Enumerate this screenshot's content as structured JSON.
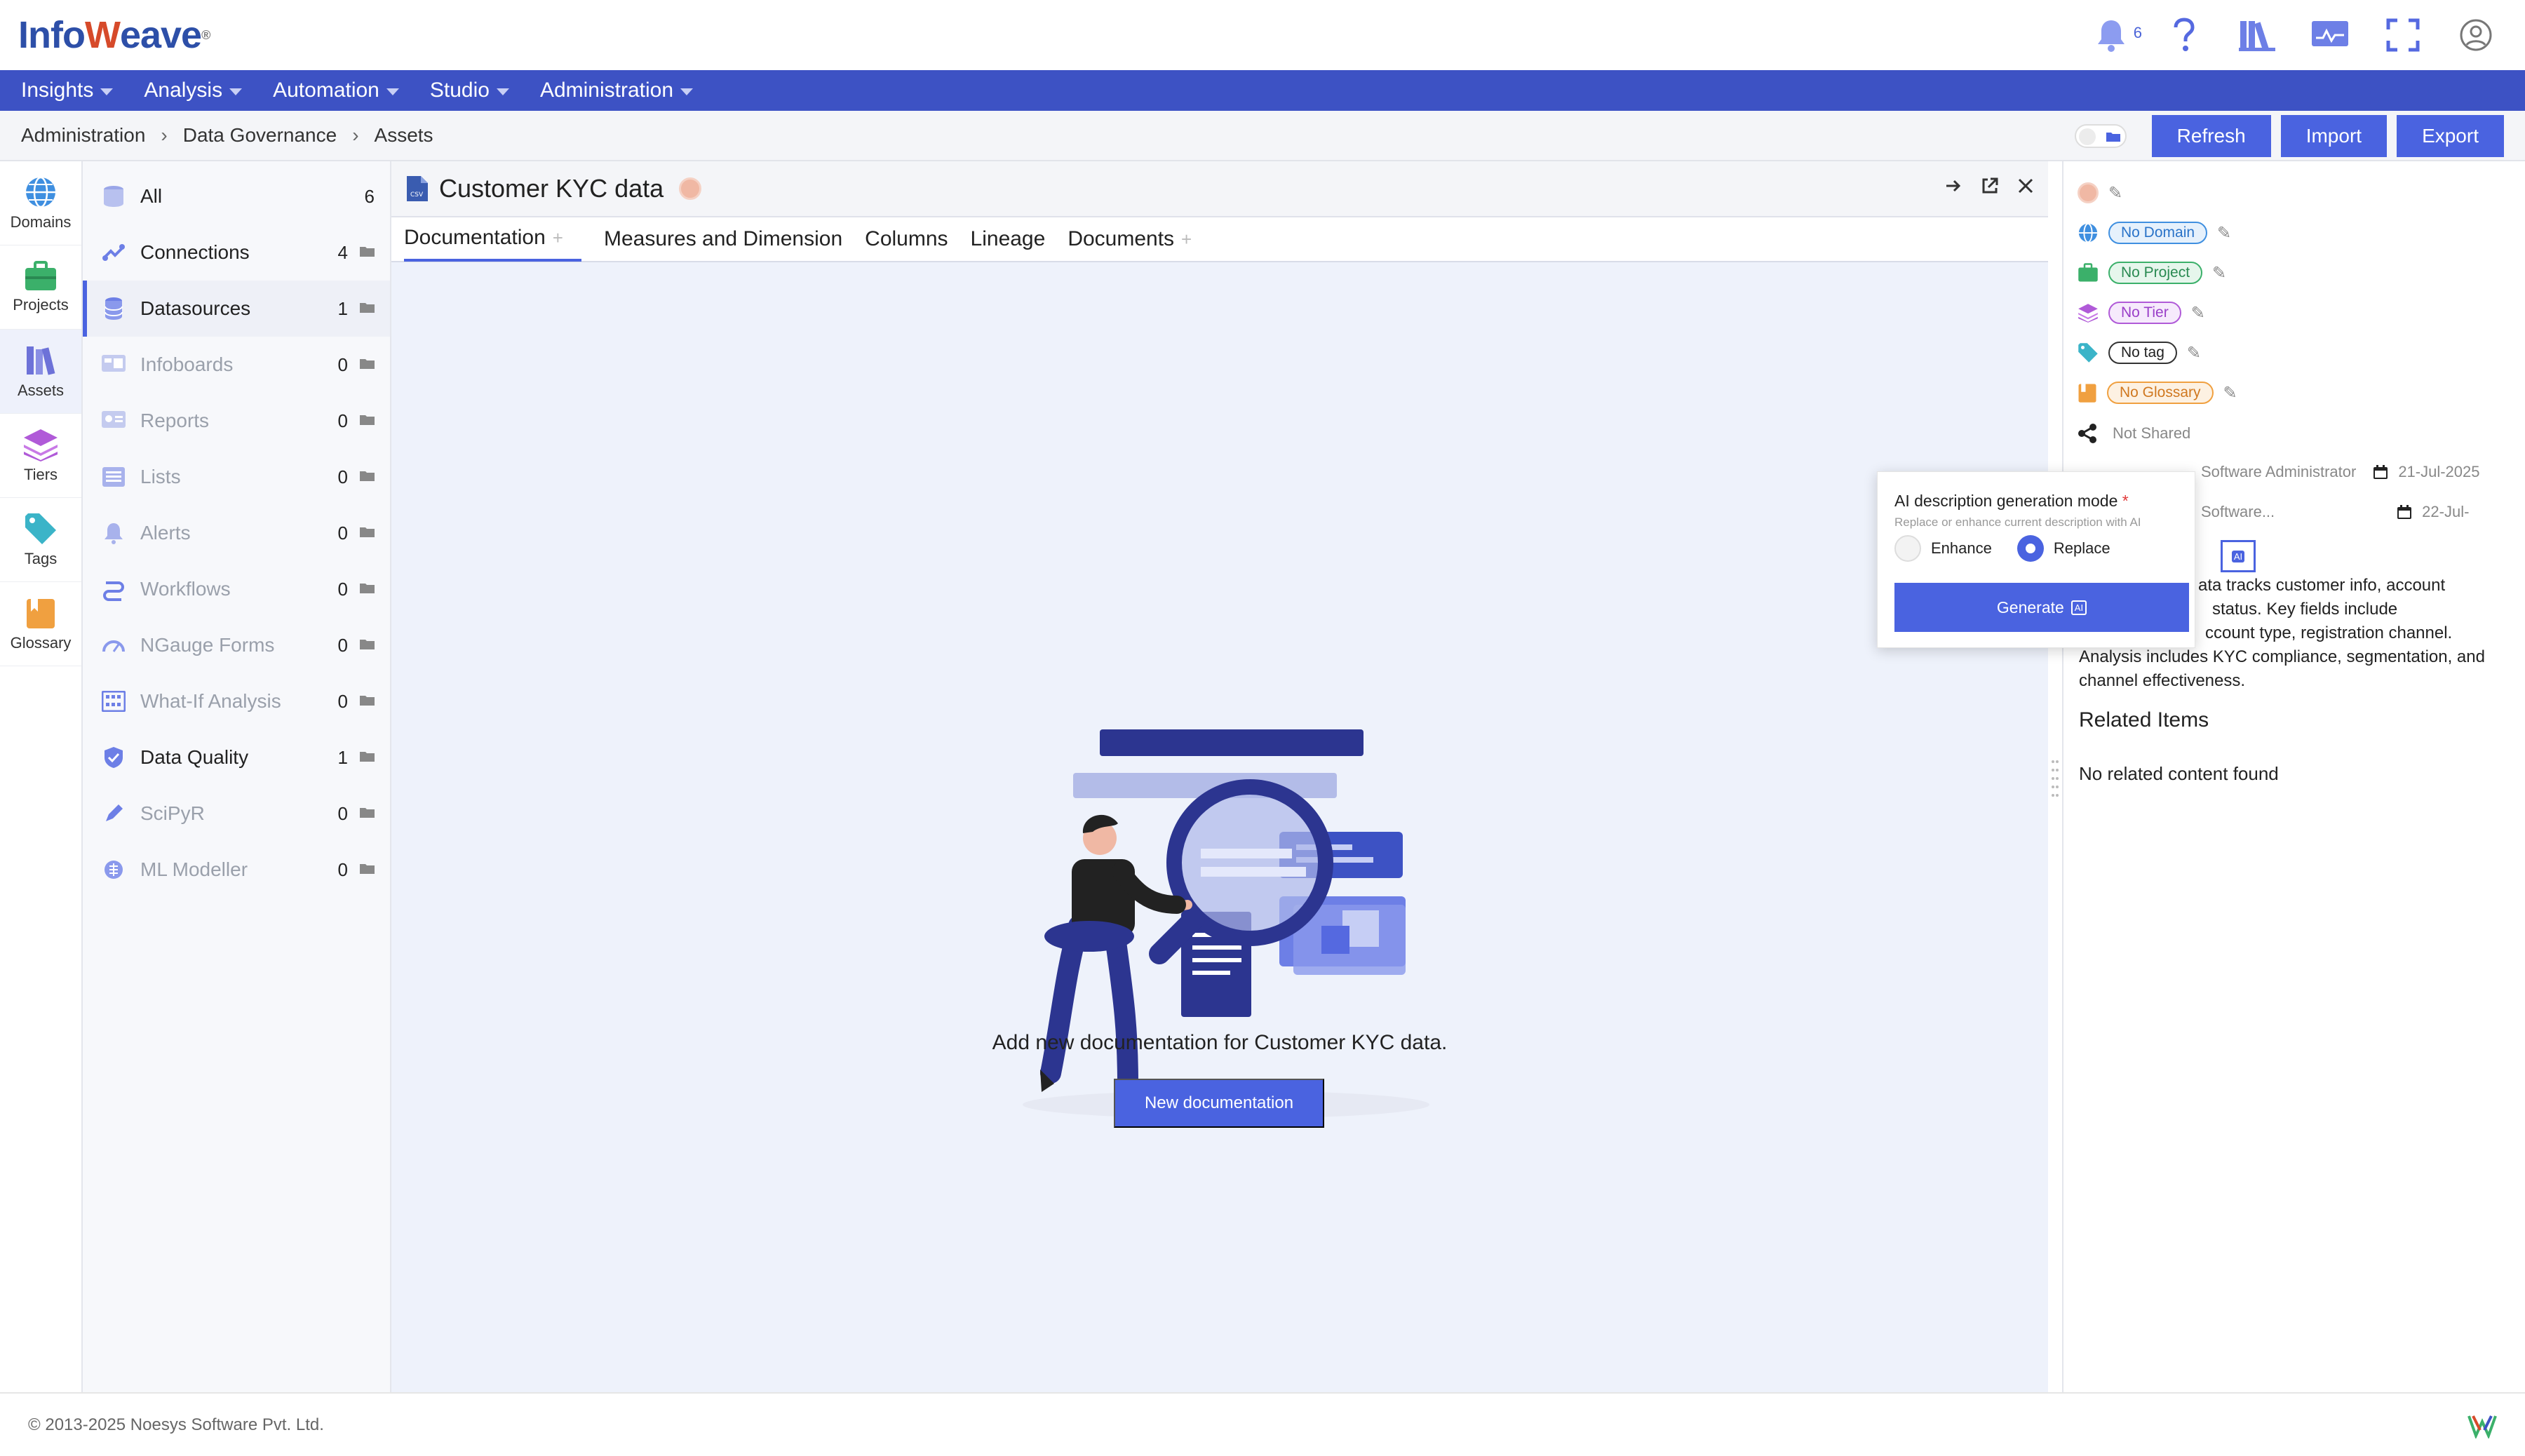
{
  "brand": {
    "logo_text_a": "Info",
    "logo_text_b": "eave",
    "logo_mark": "W",
    "trademark": "®"
  },
  "header": {
    "notification_count": "6"
  },
  "menu": [
    {
      "label": "Insights"
    },
    {
      "label": "Analysis"
    },
    {
      "label": "Automation"
    },
    {
      "label": "Studio"
    },
    {
      "label": "Administration"
    }
  ],
  "breadcrumb": [
    "Administration",
    "Data Governance",
    "Assets"
  ],
  "actions": {
    "refresh": "Refresh",
    "import": "Import",
    "export": "Export"
  },
  "rail": [
    {
      "label": "Domains",
      "icon": "globe-icon",
      "color": "#3f8fe0"
    },
    {
      "label": "Projects",
      "icon": "briefcase-icon",
      "color": "#3bb06a"
    },
    {
      "label": "Assets",
      "icon": "books-icon",
      "color": "#6d72d8"
    },
    {
      "label": "Tiers",
      "icon": "layers-icon",
      "color": "#b05ad8"
    },
    {
      "label": "Tags",
      "icon": "tag-icon",
      "color": "#3bb4c8"
    },
    {
      "label": "Glossary",
      "icon": "book-icon",
      "color": "#f0a040"
    }
  ],
  "nav": [
    {
      "label": "All",
      "count": "6"
    },
    {
      "label": "Connections",
      "count": "4"
    },
    {
      "label": "Datasources",
      "count": "1"
    },
    {
      "label": "Infoboards",
      "count": "0"
    },
    {
      "label": "Reports",
      "count": "0"
    },
    {
      "label": "Lists",
      "count": "0"
    },
    {
      "label": "Alerts",
      "count": "0"
    },
    {
      "label": "Workflows",
      "count": "0"
    },
    {
      "label": "NGauge Forms",
      "count": "0"
    },
    {
      "label": "What-If Analysis",
      "count": "0"
    },
    {
      "label": "Data Quality",
      "count": "1"
    },
    {
      "label": "SciPyR",
      "count": "0"
    },
    {
      "label": "ML Modeller",
      "count": "0"
    }
  ],
  "panel": {
    "title": "Customer KYC data",
    "file_badge": "CSV",
    "tabs": [
      "Documentation",
      "Measures and Dimension",
      "Columns",
      "Lineage",
      "Documents"
    ],
    "empty_text": "Add new documentation for Customer KYC data.",
    "new_doc_label": "New documentation"
  },
  "properties": {
    "domain": "No Domain",
    "project": "No Project",
    "tier": "No Tier",
    "tag": "No tag",
    "glossary": "No Glossary",
    "shared": "Not Shared",
    "created_by": "Software Administrator",
    "created_on": "21-Jul-2025",
    "modified_by": "Software...",
    "modified_on": "22-Jul-",
    "ai_icon": "AI",
    "description_lines": [
      "ata tracks customer info, account",
      "status. Key fields include",
      "ccount type, registration channel.",
      "Analysis includes KYC compliance, segmentation, and",
      "channel effectiveness."
    ],
    "related_heading": "Related Items",
    "related_empty": "No related content found"
  },
  "popup": {
    "title": "AI description generation mode",
    "required_mark": "*",
    "subtitle": "Replace or enhance current description with AI",
    "option_enhance": "Enhance",
    "option_replace": "Replace",
    "selected": "Replace",
    "generate_label": "Generate",
    "generate_icon": "AI"
  },
  "footer": {
    "copyright": "© 2013-2025 Noesys Software Pvt. Ltd."
  },
  "colors": {
    "accent": "#4a63e0",
    "menubar": "#3d52c4",
    "navy": "#2c3590"
  }
}
